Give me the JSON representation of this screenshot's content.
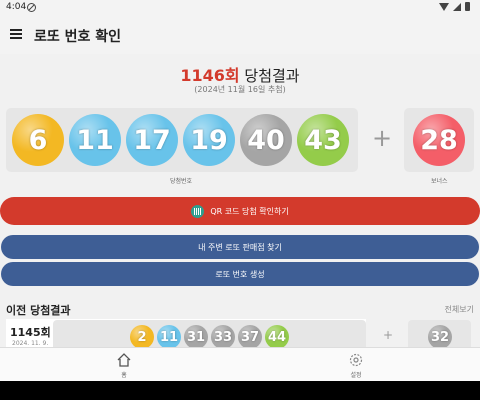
{
  "status": {
    "time": "4:04"
  },
  "appbar": {
    "title": "로또 번호 확인"
  },
  "draw": {
    "round": "1146회",
    "title_suffix": " 당첨결과",
    "date": "(2024년 11월 16일 추첨)",
    "numbers": [
      "6",
      "11",
      "17",
      "19",
      "40",
      "43"
    ],
    "bonus": "28",
    "numbers_label": "당첨번호",
    "bonus_label": "보너스",
    "colors": {
      "yellow": "#f3b823",
      "blue": "#68c3ea",
      "gray": "#a5a5a5",
      "green": "#94cc4a",
      "red": "#f45e68"
    }
  },
  "buttons": {
    "qr": "QR 코드 당첨 확인하기",
    "store": "내 주변 로또 판매점 찾기",
    "generate": "로또 번호 생성"
  },
  "previous": {
    "heading": "이전 당첨결과",
    "view_all": "전체보기",
    "round": "1145회",
    "date": "2024. 11. 9.",
    "numbers": [
      "2",
      "11",
      "31",
      "33",
      "37",
      "44"
    ],
    "bonus": "32"
  },
  "nav": {
    "home": "홈",
    "settings": "설정"
  }
}
